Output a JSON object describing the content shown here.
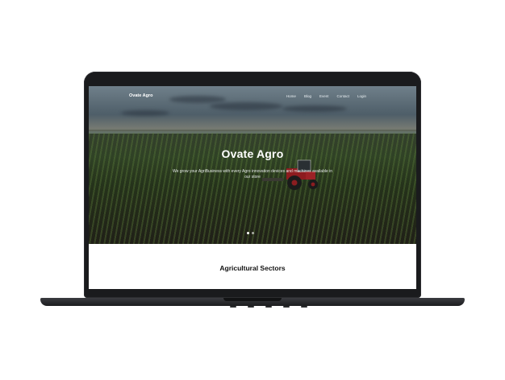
{
  "nav": {
    "brand": "Ovate Agro",
    "items": [
      "Home",
      "Blog",
      "Event",
      "Contact",
      "Login"
    ]
  },
  "hero": {
    "title": "Ovate Agro",
    "subtitle": "We grow your AgriBusiness with every Agro innovation devices and machines available in our store",
    "slides": 2,
    "active_slide": 1
  },
  "section": {
    "title": "Agricultural Sectors"
  },
  "colors": {
    "frame": "#1a1b1d",
    "text_dark": "#111111",
    "hero_text": "#ffffff"
  }
}
